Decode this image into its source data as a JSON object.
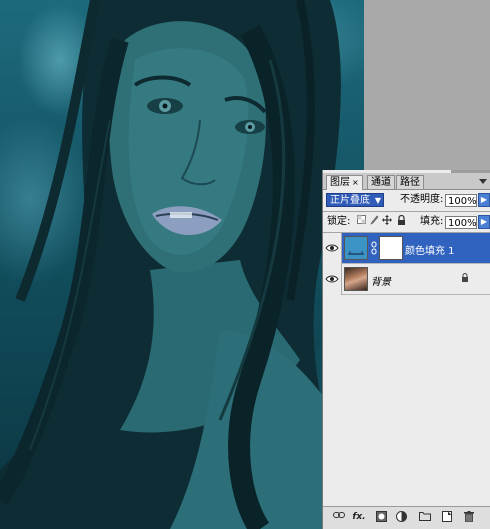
{
  "layers_panel": {
    "tabs": [
      {
        "label": "图层",
        "close": "×"
      },
      {
        "label": "通道"
      },
      {
        "label": "路径"
      }
    ],
    "blend_mode": "正片叠底",
    "opacity_label": "不透明度:",
    "opacity_value": "100%",
    "lock_label": "锁定:",
    "fill_label": "填充:",
    "fill_value": "100%",
    "layers": [
      {
        "name": "颜色填充 1",
        "selected": true,
        "thumb_color": "#3c94c6"
      },
      {
        "name": "背景",
        "selected": false
      }
    ],
    "bottom_icons": [
      "link-icon",
      "fx-icon",
      "mask-icon",
      "adjustment-icon",
      "folder-icon",
      "new-layer-icon",
      "trash-icon"
    ],
    "fx_text": "fx."
  },
  "colors": {
    "selection": "#3063c0",
    "canvas_tint": "#1d6a7d"
  }
}
